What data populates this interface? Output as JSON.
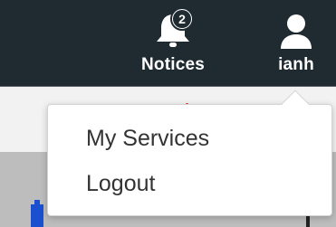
{
  "header": {
    "notices": {
      "label": "Notices",
      "badge_count": "2",
      "icon": "bell-icon"
    },
    "user": {
      "label": "ianh",
      "icon": "user-icon"
    }
  },
  "user_menu": {
    "items": [
      {
        "label": "My Services"
      },
      {
        "label": "Logout"
      }
    ]
  },
  "colors": {
    "header_bg": "#1f2a31",
    "header_text": "#ffffff",
    "menu_bg": "#ffffff",
    "menu_text": "#333333"
  }
}
